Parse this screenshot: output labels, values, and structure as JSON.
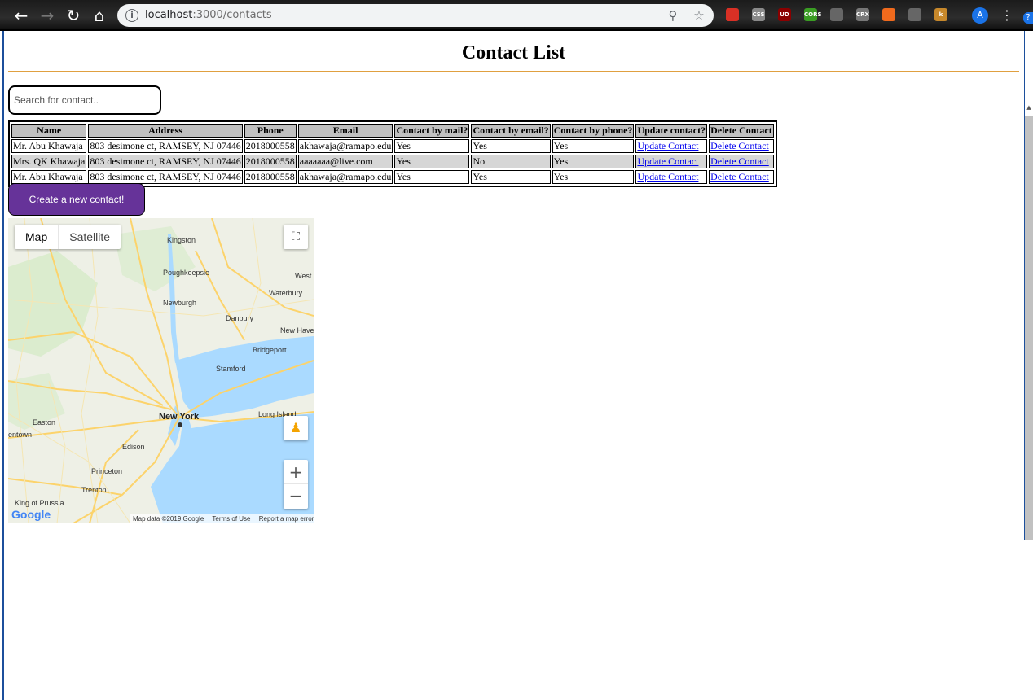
{
  "browser": {
    "url_host": "localhost",
    "url_path": ":3000/contacts",
    "icons": {
      "back": "back-arrow-icon",
      "forward": "forward-arrow-icon",
      "reload": "reload-icon",
      "home": "home-icon",
      "info": "info-icon",
      "zoom": "zoom-icon",
      "bookmark": "star-icon"
    },
    "extensions": [
      {
        "label": "",
        "color": "#d93025"
      },
      {
        "label": "CSS",
        "color": "#8a8a8a"
      },
      {
        "label": "UD",
        "color": "#8b0000"
      },
      {
        "label": "CORS",
        "color": "#3a9d23"
      },
      {
        "label": "",
        "color": "#666666"
      },
      {
        "label": "CRX",
        "color": "#777777"
      },
      {
        "label": "",
        "color": "#f06a1d"
      },
      {
        "label": "",
        "color": "#666666"
      },
      {
        "label": "k",
        "color": "#c7882b"
      }
    ],
    "profile_initial": "A"
  },
  "page": {
    "title": "Contact List",
    "search_placeholder": "Search for contact..",
    "create_button": "Create a new contact!",
    "accent_color": "#663399"
  },
  "table": {
    "headers": [
      "Name",
      "Address",
      "Phone",
      "Email",
      "Contact by mail?",
      "Contact by email?",
      "Contact by phone?",
      "Update contact?",
      "Delete Contact"
    ],
    "rows": [
      {
        "name": "Mr. Abu Khawaja",
        "address": "803 desimone ct, RAMSEY, NJ 07446",
        "phone": "2018000558",
        "email": "akhawaja@ramapo.edu",
        "by_mail": "Yes",
        "by_email": "Yes",
        "by_phone": "Yes",
        "update": "Update Contact",
        "delete": "Delete Contact"
      },
      {
        "name": "Mrs. QK Khawaja",
        "address": "803 desimone ct, RAMSEY, NJ 07446",
        "phone": "2018000558",
        "email": "aaaaaaa@live.com",
        "by_mail": "Yes",
        "by_email": "No",
        "by_phone": "Yes",
        "update": "Update Contact",
        "delete": "Delete Contact"
      },
      {
        "name": "Mr. Abu Khawaja",
        "address": "803 desimone ct, RAMSEY, NJ 07446",
        "phone": "2018000558",
        "email": "akhawaja@ramapo.edu",
        "by_mail": "Yes",
        "by_email": "Yes",
        "by_phone": "Yes",
        "update": "Update Contact",
        "delete": "Delete Contact"
      }
    ]
  },
  "map": {
    "type_map": "Map",
    "type_satellite": "Satellite",
    "fullscreen_icon": "fullscreen-icon",
    "pegman_icon": "pegman-icon",
    "zoom_in": "+",
    "zoom_out": "−",
    "logo": "Google",
    "footer_data": "Map data ©2019 Google",
    "footer_terms": "Terms of Use",
    "footer_report": "Report a map error",
    "labels": {
      "kingston": "Kingston",
      "poughkeepsie": "Poughkeepsie",
      "newburgh": "Newburgh",
      "danbury": "Danbury",
      "waterbury": "Waterbury",
      "west": "West",
      "new_haven": "New Have",
      "bridgeport": "Bridgeport",
      "stamford": "Stamford",
      "new_york": "New York",
      "long_island": "Long Island",
      "easton": "Easton",
      "entown": "entown",
      "edison": "Edison",
      "princeton": "Princeton",
      "trenton": "Trenton",
      "king_of_prussia": "King of Prussia"
    },
    "water_color": "#aadaff",
    "land_color": "#eef0e6",
    "road_color": "#fcd36b"
  }
}
